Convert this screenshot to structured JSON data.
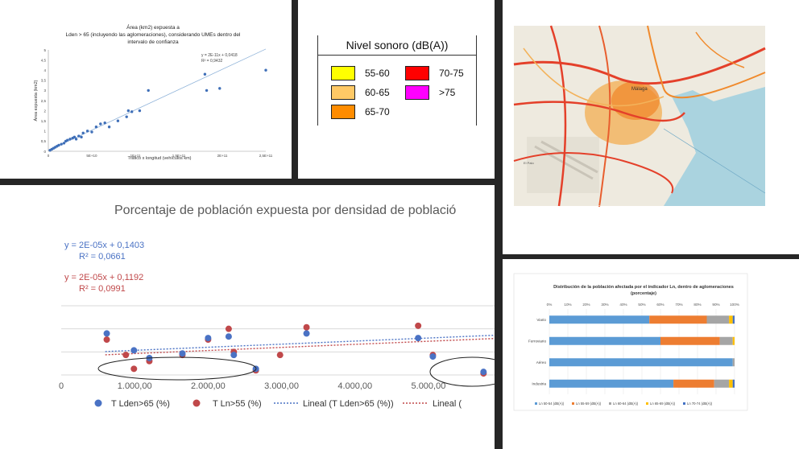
{
  "panels": {
    "scatter_area": {
      "title_lines": [
        "Área (km2) expuesta a",
        "Lden > 65 (incluyendo las aglomeraciones), considerando UMEs dentro del",
        "intervalo de confianza"
      ],
      "equation": "y = 2E-11x + 0,0418",
      "r2": "R² = 0,9432",
      "colors": {
        "points": "#3f6fb8",
        "trend": "#8fb3d9"
      }
    },
    "legend": {
      "title": "Nivel sonoro (dB(A))",
      "items": [
        {
          "label": "55-60",
          "color": "#ffff00"
        },
        {
          "label": "70-75",
          "color": "#ff0000"
        },
        {
          "label": "60-65",
          "color": "#ffc966"
        },
        {
          "label": ">75",
          "color": "#ff00ff"
        },
        {
          "label": "65-70",
          "color": "#ff8c00"
        }
      ]
    },
    "map": {
      "place_labels": [
        "Málaga",
        "El Palo"
      ]
    },
    "scatter_density": {
      "title": "Porcentaje de población expuesta por densidad de població",
      "eq_blue": "y = 2E-05x + 0,1403",
      "r2_blue": "R² = 0,0661",
      "eq_red": "y = 2E-05x + 0,1192",
      "r2_red": "R² = 0,0991",
      "legend": [
        "T Lden>65 (%)",
        "T Ln>55 (%)",
        "Lineal (T Lden>65 (%))",
        "Lineal ("
      ],
      "colors": {
        "blue": "#4a72c4",
        "red": "#c0484a",
        "grid": "#d9d9d9"
      }
    },
    "stacked_bars": {
      "title_lines": [
        "Distribución de la población afectada por el indicador Ln, dentro de aglomeraciones",
        "(porcentaje)"
      ],
      "legend": [
        "Ln 50-54 (dB(A))",
        "Ln 55-59 (dB(A))",
        "Ln 60-64 (dB(A))",
        "Ln 65-69 (dB(A))",
        "Ln 70-74 (dB(A))"
      ],
      "colors": [
        "#5b9bd5",
        "#ed7d31",
        "#a5a5a5",
        "#ffc000",
        "#4472c4"
      ]
    }
  },
  "chart_data": [
    {
      "type": "scatter",
      "title": "Área (km2) expuesta a Lden > 65 (incluyendo las aglomeraciones), considerando UMEs dentro del intervalo de confianza",
      "xlabel": "Tráfico x longitud (vehículos km)",
      "ylabel": "Área expuesta (km2)",
      "xlim": [
        0,
        250000000000
      ],
      "ylim": [
        0,
        5
      ],
      "x_ticks": [
        "0",
        "5E+10",
        "1E+11",
        "1,5E+11",
        "2E+11",
        "2,5E+11"
      ],
      "y_ticks": [
        "0",
        "0,5",
        "1",
        "1,5",
        "2",
        "2,5",
        "3",
        "3,5",
        "4",
        "4,5",
        "5"
      ],
      "points": [
        [
          2000000000.0,
          0.05
        ],
        [
          4000000000.0,
          0.1
        ],
        [
          6000000000.0,
          0.15
        ],
        [
          8000000000.0,
          0.2
        ],
        [
          10000000000.0,
          0.25
        ],
        [
          12000000000.0,
          0.3
        ],
        [
          15000000000.0,
          0.35
        ],
        [
          18000000000.0,
          0.4
        ],
        [
          20000000000.0,
          0.5
        ],
        [
          22000000000.0,
          0.55
        ],
        [
          25000000000.0,
          0.6
        ],
        [
          28000000000.0,
          0.65
        ],
        [
          30000000000.0,
          0.7
        ],
        [
          32000000000.0,
          0.6
        ],
        [
          35000000000.0,
          0.75
        ],
        [
          38000000000.0,
          0.7
        ],
        [
          40000000000.0,
          0.9
        ],
        [
          45000000000.0,
          1.0
        ],
        [
          50000000000.0,
          0.95
        ],
        [
          55000000000.0,
          1.2
        ],
        [
          60000000000.0,
          1.35
        ],
        [
          65000000000.0,
          1.4
        ],
        [
          70000000000.0,
          1.2
        ],
        [
          80000000000.0,
          1.5
        ],
        [
          90000000000.0,
          1.7
        ],
        [
          92000000000.0,
          2.0
        ],
        [
          96000000000.0,
          1.95
        ],
        [
          105000000000.0,
          2.0
        ],
        [
          115000000000.0,
          3.0
        ],
        [
          180000000000.0,
          3.8
        ],
        [
          182000000000.0,
          3.0
        ],
        [
          197000000000.0,
          3.1
        ],
        [
          250000000000.0,
          4.0
        ]
      ],
      "trend": {
        "slope": 2e-11,
        "intercept": 0.0418
      }
    },
    {
      "type": "scatter",
      "title": "Porcentaje de población expuesta por densidad de població",
      "x_ticks": [
        "0",
        "1.000,00",
        "2.000,00",
        "3.000,00",
        "4.000,00",
        "5.000,00"
      ],
      "xlim": [
        0,
        5900
      ],
      "ylim": [
        0,
        0.45
      ],
      "series": [
        {
          "name": "T Lden>65 (%)",
          "points": [
            [
              620,
              0.27
            ],
            [
              990,
              0.16
            ],
            [
              1200,
              0.11
            ],
            [
              1650,
              0.14
            ],
            [
              2000,
              0.24
            ],
            [
              2280,
              0.25
            ],
            [
              2350,
              0.13
            ],
            [
              2650,
              0.04
            ],
            [
              3340,
              0.27
            ],
            [
              4860,
              0.24
            ],
            [
              5060,
              0.12
            ],
            [
              5750,
              0.02
            ]
          ]
        },
        {
          "name": "T Ln>55 (%)",
          "points": [
            [
              620,
              0.23
            ],
            [
              880,
              0.13
            ],
            [
              990,
              0.04
            ],
            [
              1200,
              0.09
            ],
            [
              1650,
              0.13
            ],
            [
              2000,
              0.23
            ],
            [
              2280,
              0.3
            ],
            [
              2350,
              0.15
            ],
            [
              2650,
              0.03
            ],
            [
              2980,
              0.13
            ],
            [
              3340,
              0.31
            ],
            [
              4860,
              0.32
            ],
            [
              5060,
              0.13
            ],
            [
              5750,
              0.01
            ]
          ]
        }
      ],
      "trends": [
        {
          "name": "Lineal (T Lden>65 (%))",
          "slope": 2e-05,
          "intercept": 0.1403
        },
        {
          "name": "Lineal (",
          "slope": 2e-05,
          "intercept": 0.1192
        }
      ]
    },
    {
      "type": "bar",
      "title": "Distribución de la población afectada por el indicador Ln, dentro de aglomeraciones (porcentaje)",
      "categories": [
        "Viario",
        "Ferroviario",
        "Aéreo",
        "Industria"
      ],
      "x_ticks": [
        "0%",
        "10%",
        "20%",
        "30%",
        "40%",
        "50%",
        "60%",
        "70%",
        "80%",
        "90%",
        "100%"
      ],
      "series": [
        {
          "name": "Ln 50-54 (dB(A))",
          "values": [
            54,
            60,
            99,
            67
          ]
        },
        {
          "name": "Ln 55-59 (dB(A))",
          "values": [
            31,
            32,
            0,
            22
          ]
        },
        {
          "name": "Ln 60-64 (dB(A))",
          "values": [
            12,
            7,
            1,
            8
          ]
        },
        {
          "name": "Ln 65-69 (dB(A))",
          "values": [
            2,
            1,
            0,
            2
          ]
        },
        {
          "name": "Ln 70-74 (dB(A))",
          "values": [
            1,
            0,
            0,
            1
          ]
        }
      ]
    }
  ]
}
